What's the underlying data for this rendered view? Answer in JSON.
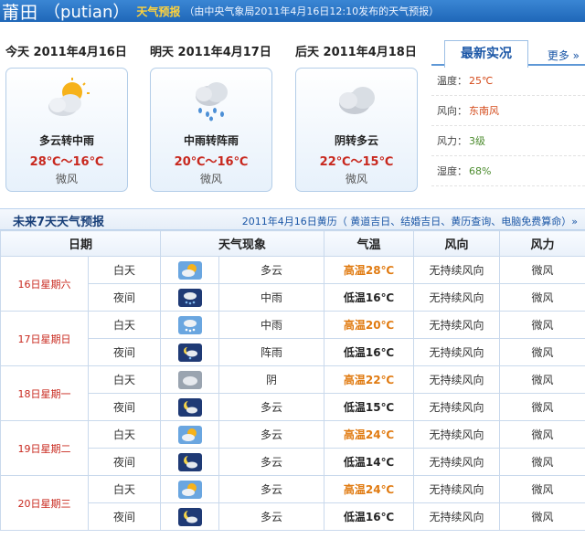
{
  "header": {
    "city": "莆田",
    "pinyin": "（putian）",
    "badge": "天气预报",
    "source": "（由中央气象局2011年4月16日12:10发布的天气预报）"
  },
  "days": [
    {
      "title": "今天  2011年4月16日",
      "icon": "cloudy-sun-icon",
      "desc": "多云转中雨",
      "temp": "28℃～16℃",
      "wind": "微风"
    },
    {
      "title": "明天  2011年4月17日",
      "icon": "rain-cloud-icon",
      "desc": "中雨转阵雨",
      "temp": "20℃～16℃",
      "wind": "微风"
    },
    {
      "title": "后天  2011年4月18日",
      "icon": "cloud-icon",
      "desc": "阴转多云",
      "temp": "22℃～15℃",
      "wind": "微风"
    }
  ],
  "realtime": {
    "tab": "最新实况",
    "more": "更多 »",
    "rows": [
      {
        "label": "温度：",
        "value": "25℃",
        "color": "#d44a1a"
      },
      {
        "label": "风向：",
        "value": "东南风",
        "color": "#d44a1a"
      },
      {
        "label": "风力：",
        "value": "3级",
        "color": "#4b8b2d"
      },
      {
        "label": "湿度：",
        "value": "68%",
        "color": "#4b8b2d"
      }
    ]
  },
  "forecast": {
    "title": "未来7天天气预报",
    "almanac": "2011年4月16日黄历（ 黄道吉日、结婚吉日、黄历查询、电脑免费算命）»",
    "headers": [
      "日期",
      "天气现象",
      "气温",
      "风向",
      "风力"
    ],
    "rows": [
      {
        "date": "16日星期六",
        "day": {
          "period": "白天",
          "icon": "sun-cloud-icon",
          "weather": "多云",
          "temp": "高温28℃",
          "dir": "无持续风向",
          "force": "微风"
        },
        "night": {
          "period": "夜间",
          "icon": "night-rain-icon",
          "weather": "中雨",
          "temp": "低温16℃",
          "dir": "无持续风向",
          "force": "微风"
        }
      },
      {
        "date": "17日星期日",
        "day": {
          "period": "白天",
          "icon": "rain-icon",
          "weather": "中雨",
          "temp": "高温20℃",
          "dir": "无持续风向",
          "force": "微风"
        },
        "night": {
          "period": "夜间",
          "icon": "night-showers-icon",
          "weather": "阵雨",
          "temp": "低温16℃",
          "dir": "无持续风向",
          "force": "微风"
        }
      },
      {
        "date": "18日星期一",
        "day": {
          "period": "白天",
          "icon": "overcast-icon",
          "weather": "阴",
          "temp": "高温22℃",
          "dir": "无持续风向",
          "force": "微风"
        },
        "night": {
          "period": "夜间",
          "icon": "moon-cloud-icon",
          "weather": "多云",
          "temp": "低温15℃",
          "dir": "无持续风向",
          "force": "微风"
        }
      },
      {
        "date": "19日星期二",
        "day": {
          "period": "白天",
          "icon": "sun-cloud-icon",
          "weather": "多云",
          "temp": "高温24℃",
          "dir": "无持续风向",
          "force": "微风"
        },
        "night": {
          "period": "夜间",
          "icon": "moon-cloud-icon",
          "weather": "多云",
          "temp": "低温14℃",
          "dir": "无持续风向",
          "force": "微风"
        }
      },
      {
        "date": "20日星期三",
        "day": {
          "period": "白天",
          "icon": "sun-cloud-icon",
          "weather": "多云",
          "temp": "高温24℃",
          "dir": "无持续风向",
          "force": "微风"
        },
        "night": {
          "period": "夜间",
          "icon": "moon-cloud-icon",
          "weather": "多云",
          "temp": "低温16℃",
          "dir": "无持续风向",
          "force": "微风"
        }
      }
    ]
  }
}
